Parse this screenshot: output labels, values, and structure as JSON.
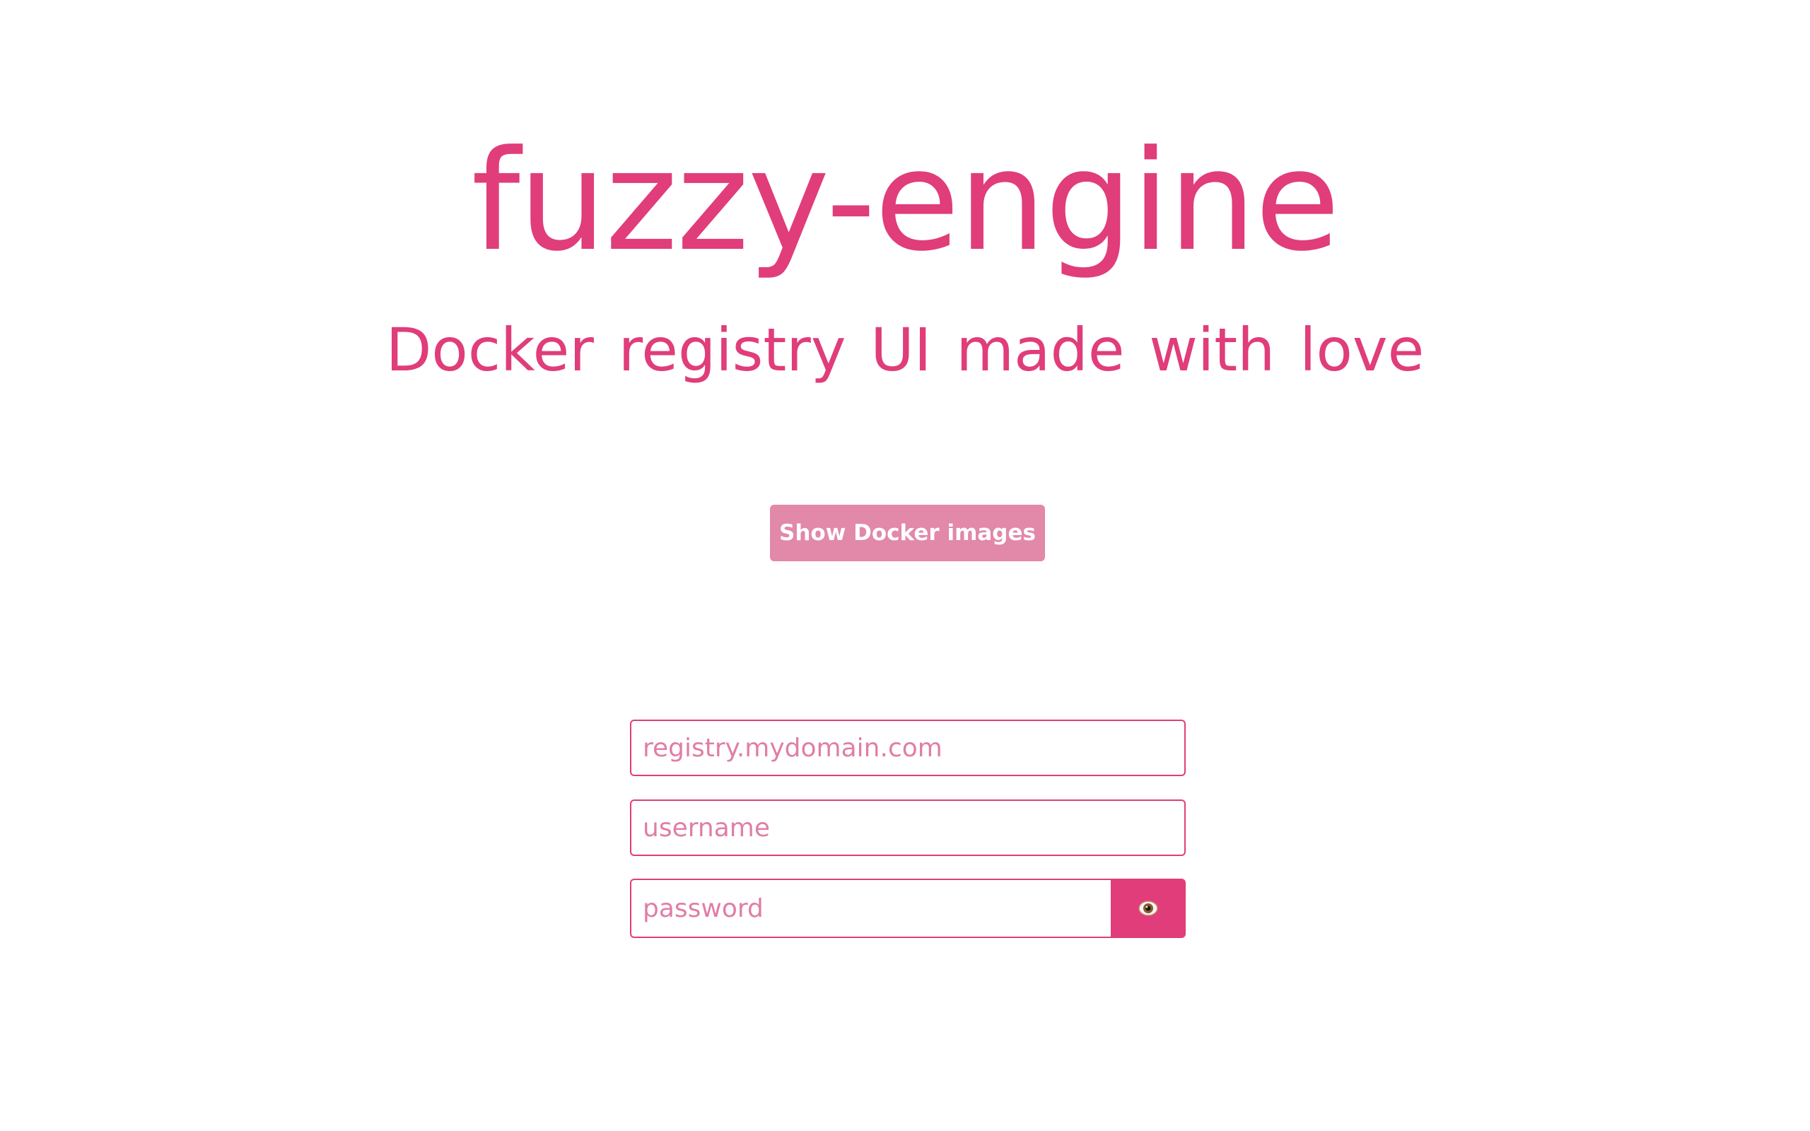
{
  "header": {
    "title": "fuzzy-engine",
    "subtitle": "Docker registry UI made with love"
  },
  "actions": {
    "show_images_label": "Show Docker images"
  },
  "form": {
    "registry_placeholder": "registry.mydomain.com",
    "registry_value": "",
    "username_placeholder": "username",
    "username_value": "",
    "password_placeholder": "password",
    "password_value": "",
    "toggle_icon": "eye-icon"
  },
  "colors": {
    "accent": "#e03d7a",
    "button_muted": "#e288a8",
    "placeholder": "#e07ea6",
    "background": "#ffffff"
  }
}
